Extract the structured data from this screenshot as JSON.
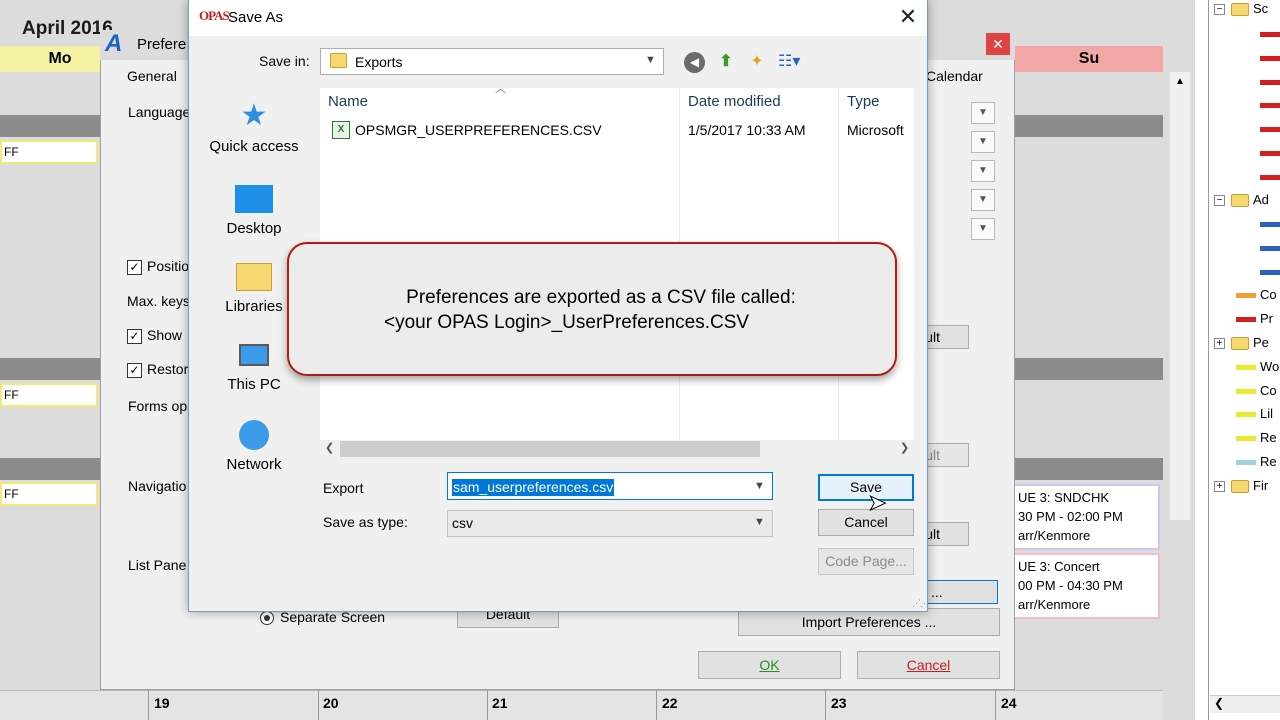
{
  "calendar": {
    "month_title": "April 2016",
    "day_mo": "Mo",
    "day_su": "Su",
    "ff_label": "FF",
    "events": [
      {
        "line1": "UE 3: SNDCHK",
        "line2": "30 PM - 02:00 PM",
        "line3": "arr/Kenmore"
      },
      {
        "line1": "UE 3: Concert",
        "line2": "00 PM - 04:30 PM",
        "line3": "arr/Kenmore"
      }
    ],
    "dates": [
      "19",
      "20",
      "21",
      "22",
      "23",
      "24"
    ]
  },
  "tree": {
    "items": [
      {
        "toggle": "−",
        "label": "Sc"
      },
      {
        "toggle": "−",
        "label": "Ad"
      },
      {
        "label": "Co"
      },
      {
        "label": "Pr"
      },
      {
        "toggle": "+",
        "label": "Pe"
      },
      {
        "label": "Wo"
      },
      {
        "label": "Co"
      },
      {
        "label": "Lil"
      },
      {
        "label": "Re"
      },
      {
        "label": "Re"
      },
      {
        "toggle": "+",
        "label": "Fir"
      }
    ],
    "colors": {
      "red": "#d21f1f",
      "blue": "#2f5fbf",
      "orange": "#f0a030",
      "yellow": "#e9e930",
      "cyan": "#9fd6dc"
    }
  },
  "prefs": {
    "title": "Prefere",
    "tab_general": "General",
    "tab_calendar": "Calendar",
    "language_label": "Language",
    "position_label": "Positio",
    "max_keys_label": "Max. keys",
    "show_label": "Show",
    "restore_label": "Restor",
    "forms_label": "Forms op",
    "navigation_label": "Navigatio",
    "list_pane_label": "List Pane",
    "default_btn_partial": "ult",
    "separate_screen_label": "Separate Screen",
    "default_label": "Default",
    "import_btn": "Import Preferences ...",
    "ok_btn": "OK",
    "cancel_btn": "Cancel",
    "ellipsis_btn": "..."
  },
  "saveas": {
    "logo": "OPAS",
    "title": "Save As",
    "save_in_label": "Save in:",
    "save_in_value": "Exports",
    "nav": [
      "Quick access",
      "Desktop",
      "Libraries",
      "This PC",
      "Network"
    ],
    "columns": {
      "name": "Name",
      "date": "Date modified",
      "type": "Type"
    },
    "files": [
      {
        "name": "OPSMGR_USERPREFERENCES.CSV",
        "date": "1/5/2017 10:33 AM",
        "type": "Microsoft"
      }
    ],
    "filename_label": "Export",
    "filename_value": "sam_userpreferences.csv",
    "type_label": "Save as type:",
    "type_value": "csv",
    "save_btn": "Save",
    "cancel_btn": "Cancel",
    "codepage_btn": "Code Page..."
  },
  "callout": {
    "line1": "Preferences are exported as a CSV file called:",
    "line2": "<your OPAS Login>_UserPreferences.CSV"
  }
}
